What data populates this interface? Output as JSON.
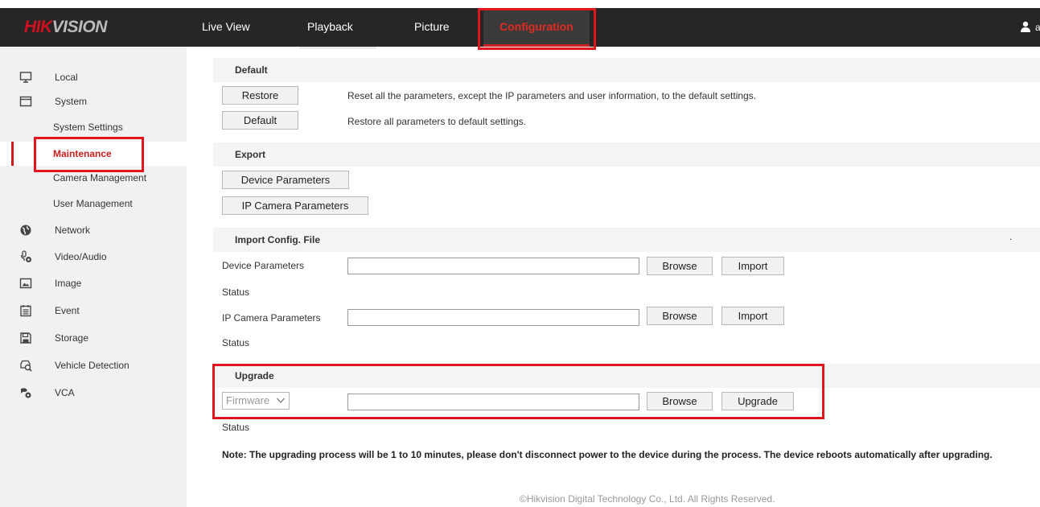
{
  "header": {
    "logo_red": "HIK",
    "logo_rest": "VISION",
    "nav": [
      "Live View",
      "Playback",
      "Picture"
    ],
    "nav_active": "Configuration"
  },
  "sidebar": {
    "items": [
      {
        "label": "Local",
        "icon": "monitor-icon"
      },
      {
        "label": "System",
        "icon": "system-icon"
      },
      {
        "label": "System Settings"
      },
      {
        "label": "Maintenance"
      },
      {
        "label": "Camera Management"
      },
      {
        "label": "User Management"
      },
      {
        "label": "Network",
        "icon": "globe-icon"
      },
      {
        "label": "Video/Audio",
        "icon": "microphone-icon"
      },
      {
        "label": "Image",
        "icon": "image-icon"
      },
      {
        "label": "Event",
        "icon": "calendar-icon"
      },
      {
        "label": "Storage",
        "icon": "floppy-icon"
      },
      {
        "label": "Vehicle Detection",
        "icon": "vehicle-search-icon"
      },
      {
        "label": "VCA",
        "icon": "vca-icon"
      }
    ]
  },
  "default_section": {
    "title": "Default",
    "restore_label": "Restore",
    "restore_desc": "Reset all the parameters, except the IP parameters and user information, to the default settings.",
    "default_label": "Default",
    "default_desc": "Restore all parameters to default settings."
  },
  "export_section": {
    "title": "Export",
    "device_params_label": "Device Parameters",
    "ip_camera_params_label": "IP Camera Parameters"
  },
  "import_section": {
    "title": "Import Config. File",
    "dot": ".",
    "device_params_label": "Device Parameters",
    "ip_camera_params_label": "IP Camera Parameters",
    "status_label": "Status",
    "browse_label": "Browse",
    "import_label": "Import"
  },
  "upgrade_section": {
    "title": "Upgrade",
    "select_value": "Firmware",
    "browse_label": "Browse",
    "upgrade_label": "Upgrade",
    "status_label": "Status",
    "note": "Note: The upgrading process will be 1 to 10 minutes, please don't disconnect power to the device during the process. The device reboots automatically after upgrading."
  },
  "footer": "©Hikvision Digital Technology Co., Ltd. All Rights Reserved.",
  "colors": {
    "accent": "#e0161e",
    "topbar": "#262626",
    "sidebar": "#f1f1f1"
  }
}
